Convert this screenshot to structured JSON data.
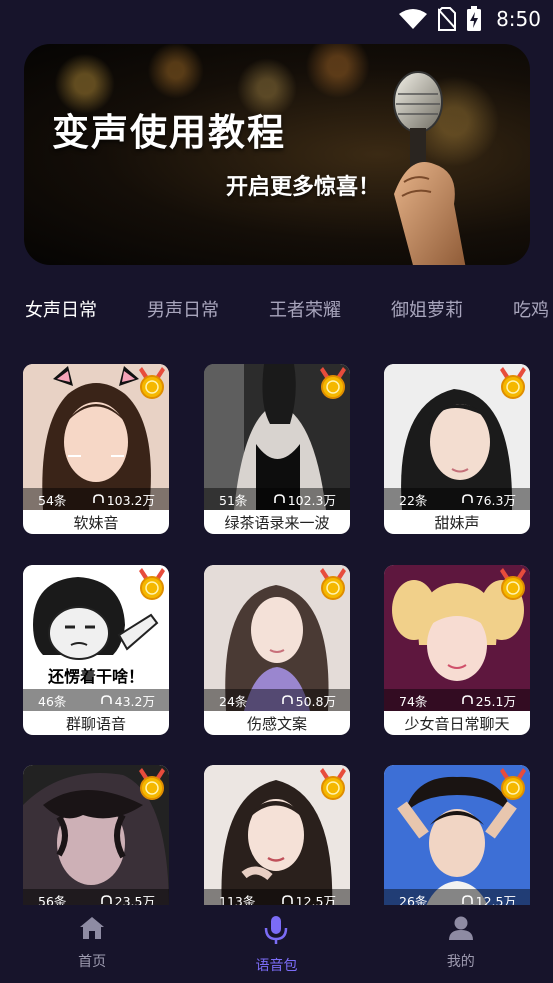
{
  "status_bar": {
    "time": "8:50"
  },
  "banner": {
    "title": "变声使用教程",
    "subtitle": "开启更多惊喜！"
  },
  "tabs": [
    {
      "label": "女声日常",
      "active": true
    },
    {
      "label": "男声日常"
    },
    {
      "label": "王者荣耀"
    },
    {
      "label": "御姐萝莉"
    },
    {
      "label": "吃鸡"
    }
  ],
  "cards": [
    {
      "name": "软妹音",
      "count": "54条",
      "plays": "103.2万"
    },
    {
      "name": "绿茶语录来一波",
      "count": "51条",
      "plays": "102.3万"
    },
    {
      "name": "甜妹声",
      "count": "22条",
      "plays": "76.3万"
    },
    {
      "name": "群聊语音",
      "count": "46条",
      "plays": "43.2万",
      "meme_text": "还愣着干啥！"
    },
    {
      "name": "伤感文案",
      "count": "24条",
      "plays": "50.8万"
    },
    {
      "name": "少女音日常聊天",
      "count": "74条",
      "plays": "25.1万"
    },
    {
      "name": "",
      "count": "56条",
      "plays": "23.5万"
    },
    {
      "name": "",
      "count": "113条",
      "plays": "12.5万"
    },
    {
      "name": "",
      "count": "26条",
      "plays": "12.5万"
    }
  ],
  "bottom_nav": [
    {
      "label": "首页",
      "icon": "home-icon"
    },
    {
      "label": "语音包",
      "icon": "microphone-icon",
      "active": true
    },
    {
      "label": "我的",
      "icon": "profile-icon"
    }
  ],
  "colors": {
    "background": "#17142b",
    "accent": "#7b6cf6"
  }
}
